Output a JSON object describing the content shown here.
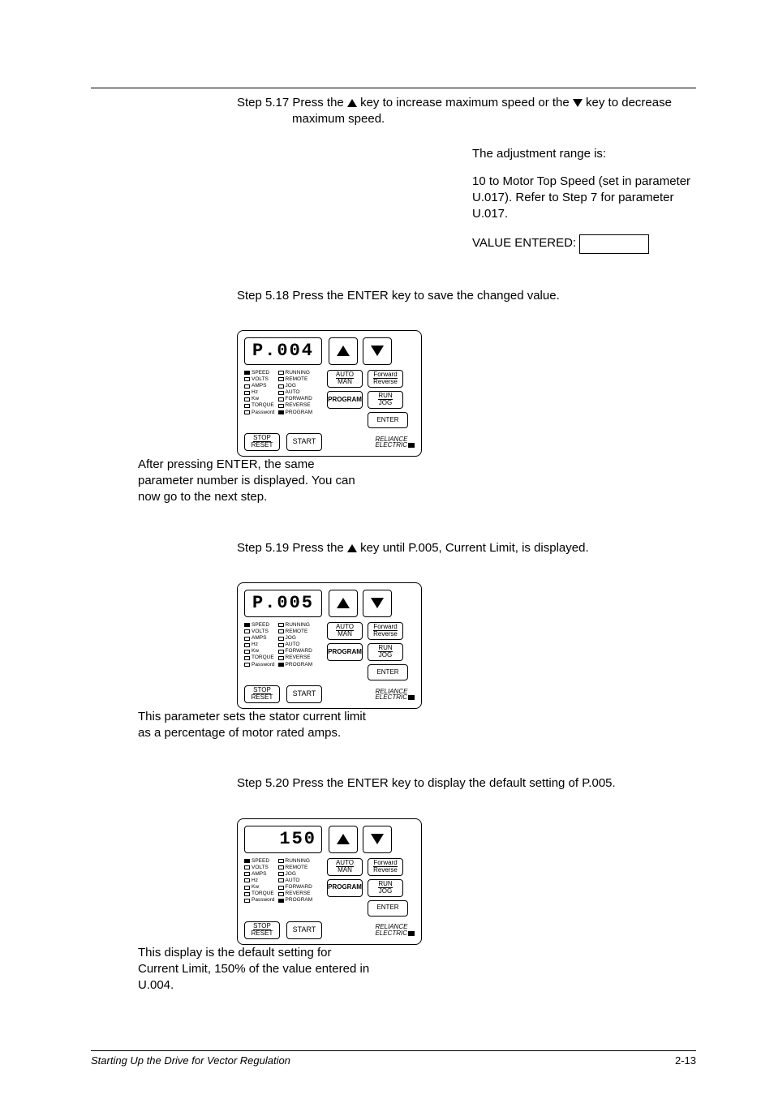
{
  "step517": {
    "label": "Step 5.17",
    "pre": "Press the ",
    "mid": " key to increase maximum speed or the ",
    "post": " key to decrease maximum speed."
  },
  "right517": {
    "range_intro": "The adjustment range is:",
    "range_body": "10 to Motor Top Speed (set in parameter U.017). Refer to Step 7 for parameter U.017.",
    "value_entered": "VALUE ENTERED:"
  },
  "step518": {
    "label": "Step 5.18",
    "text": "Press the ENTER key to save the changed value."
  },
  "right518": "After pressing ENTER, the same parameter number is displayed. You can now go to the next step.",
  "step519": {
    "label": "Step 5.19",
    "pre": "Press the ",
    "post": " key until P.005, Current Limit, is displayed."
  },
  "right519": "This parameter sets the stator current limit as a percentage of motor rated amps.",
  "step520": {
    "label": "Step 5.20",
    "text": "Press the ENTER key to display the default setting of P.005."
  },
  "right520": "This display is the default setting for Current Limit, 150% of the value entered in U.004.",
  "panel": {
    "display_p004": "P.004",
    "display_p005": "P.005",
    "display_150": "150",
    "leds_left": [
      "SPEED",
      "VOLTS",
      "AMPS",
      "Hz",
      "Kw",
      "TORQUE",
      "Password"
    ],
    "leds_right": [
      "RUNNING",
      "REMOTE",
      "JOG",
      "AUTO",
      "FORWARD",
      "REVERSE",
      "PROGRAM"
    ],
    "led_left_on": {
      "SPEED": true
    },
    "led_right_on_p": {
      "PROGRAM": true
    },
    "led_pw_on": true,
    "auto": "AUTO",
    "man": "MAN",
    "forward": "Forward",
    "reverse": "Reverse",
    "program": "PROGRAM",
    "run": "RUN",
    "jog": "JOG",
    "enter": "ENTER",
    "stop": "STOP",
    "reset": "RESET",
    "start": "START",
    "brand1": "RELIANCE",
    "brand2": "ELECTRIC"
  },
  "footer": {
    "left": "Starting Up the Drive for Vector Regulation",
    "right": "2-13"
  }
}
